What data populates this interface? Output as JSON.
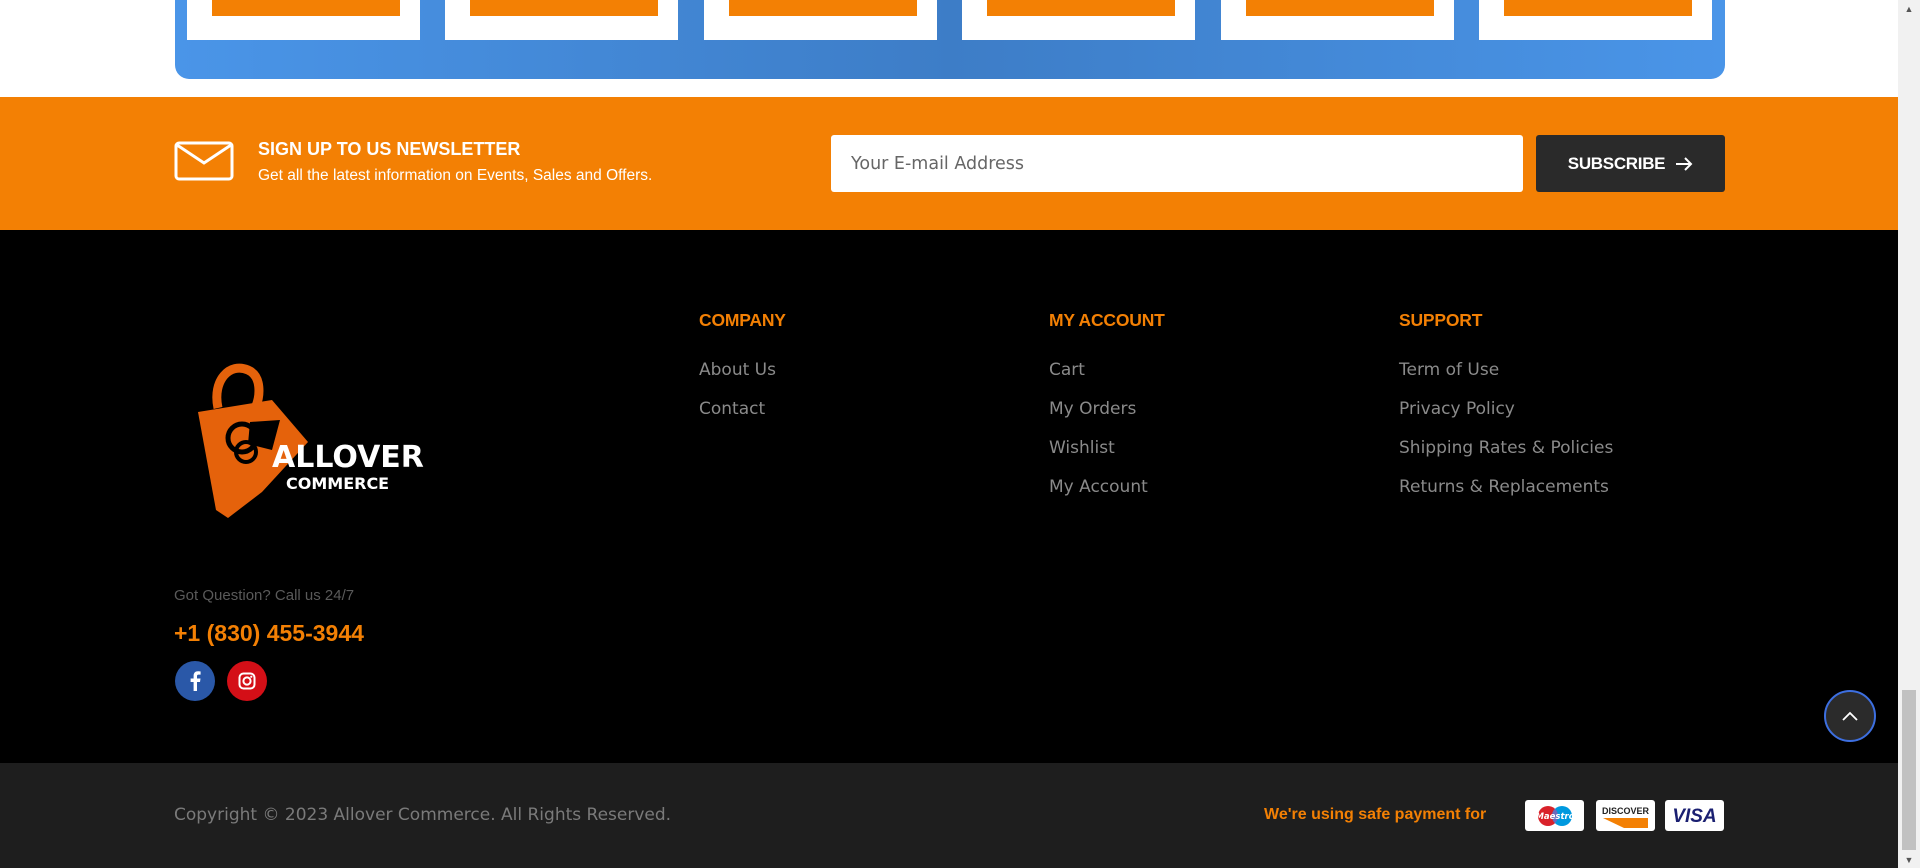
{
  "newsletter": {
    "title": "SIGN UP TO US NEWSLETTER",
    "subtitle": "Get all the latest information on Events, Sales and Offers.",
    "email_placeholder": "Your E-mail Address",
    "subscribe_label": "SUBSCRIBE",
    "icon": "envelope-icon"
  },
  "brand": {
    "name": "ALLOVER",
    "tagline": "COMMERCE",
    "color": "#f38004"
  },
  "contact": {
    "question": "Got Question? Call us 24/7",
    "phone": "+1 (830) 455-3944"
  },
  "social": [
    {
      "name": "facebook-icon",
      "color": "#2a58a8"
    },
    {
      "name": "instagram-icon",
      "color": "#d40f17"
    }
  ],
  "columns": {
    "company": {
      "title": "COMPANY",
      "links": [
        "About Us",
        "Contact"
      ]
    },
    "account": {
      "title": "MY ACCOUNT",
      "links": [
        "Cart",
        "My Orders",
        "Wishlist",
        "My Account"
      ]
    },
    "support": {
      "title": "SUPPORT",
      "links": [
        "Term of Use",
        "Privacy Policy",
        "Shipping Rates & Policies",
        "Returns & Replacements"
      ]
    }
  },
  "bottom": {
    "copyright": "Copyright © 2023 Allover Commerce. All Rights Reserved.",
    "safe_payment": "We're using safe payment for",
    "payments": [
      "Maestro",
      "DISCOVER",
      "VISA"
    ]
  },
  "colors": {
    "accent": "#f38004",
    "panel_blue": "#3d7dc7",
    "footer_bg": "#000000",
    "bottom_bg": "#1e1e1e"
  }
}
